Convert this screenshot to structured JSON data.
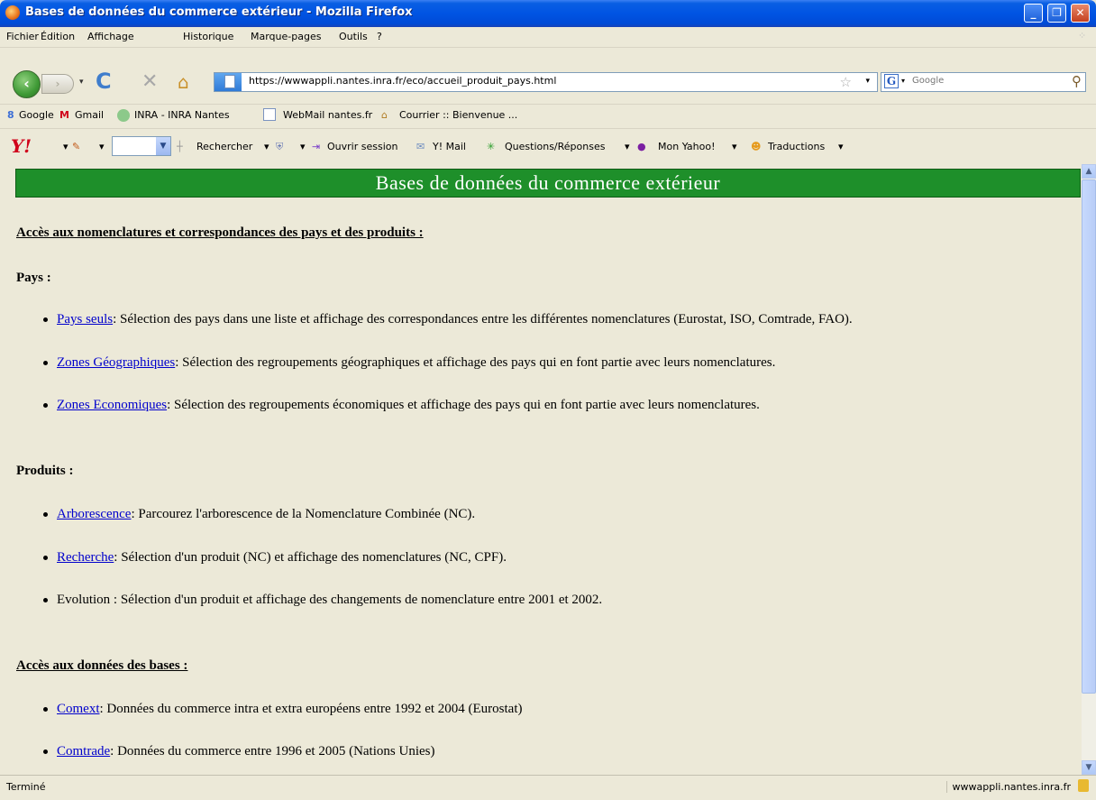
{
  "window": {
    "title": "Bases de données du commerce extérieur - Mozilla Firefox"
  },
  "menu": [
    "Fichier",
    "Édition",
    "Affichage",
    "Historique",
    "Marque-pages",
    "Outils",
    "?"
  ],
  "navbar": {
    "url": "https://wwwappli.nantes.inra.fr/eco/accueil_produit_pays.html",
    "search_placeholder": "Google"
  },
  "bookmarks": [
    "Google",
    "Gmail",
    "INRA - INRA Nantes",
    "WebMail nantes.fr",
    "Courrier :: Bienvenue ..."
  ],
  "yahoo": {
    "rechercher": "Rechercher",
    "ouvrir_session": "Ouvrir session",
    "mail": "Y! Mail",
    "questions": "Questions/Réponses",
    "mon_yahoo": "Mon Yahoo!",
    "traductions": "Traductions"
  },
  "page": {
    "banner": "Bases de données du commerce extérieur",
    "section1": "Accès aux nomenclatures et correspondances des pays et des produits :",
    "pays_heading": "Pays :",
    "pays_items": [
      {
        "link": "Pays seuls",
        "text": ": Sélection des pays dans une liste et affichage des correspondances entre les différentes nomenclatures (Eurostat, ISO, Comtrade, FAO)."
      },
      {
        "link": "Zones Géographiques",
        "text": ": Sélection des regroupements géographiques et affichage des pays qui en font partie avec leurs nomenclatures."
      },
      {
        "link": "Zones Economiques",
        "text": ": Sélection des regroupements économiques et affichage des pays qui en font partie avec leurs nomenclatures."
      }
    ],
    "produits_heading": "Produits :",
    "produits_items": [
      {
        "link": "Arborescence",
        "text": ": Parcourez l'arborescence de la Nomenclature Combinée (NC)."
      },
      {
        "link": "Recherche",
        "text": ": Sélection d'un produit (NC) et affichage des nomenclatures (NC, CPF)."
      },
      {
        "text": "Evolution : Sélection d'un produit et affichage des changements de nomenclature entre 2001 et 2002."
      }
    ],
    "section2": "Accès aux données des bases :",
    "data_items": [
      {
        "link": "Comext",
        "text": ": Données du commerce intra et extra européens entre 1992 et 2004 (Eurostat)"
      },
      {
        "link": "Comtrade",
        "text": ": Données du commerce entre 1996 et 2005 (Nations Unies)"
      }
    ]
  },
  "status": {
    "text": "Terminé",
    "host": "wwwappli.nantes.inra.fr"
  }
}
